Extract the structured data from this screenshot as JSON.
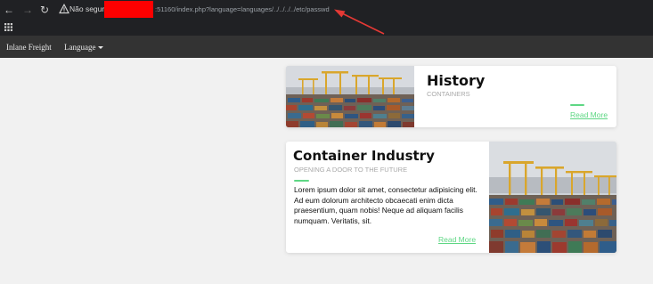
{
  "browser": {
    "security_label": "Não seguro",
    "url": ":51160/index.php?language=languages/../../../../etc/passwd",
    "icons": [
      "back-arrow-icon",
      "forward-arrow-icon",
      "reload-icon",
      "warning-triangle-icon",
      "apps-grid-icon"
    ]
  },
  "nav": {
    "brand": "Inlane Freight",
    "language_menu": "Language"
  },
  "cards": {
    "history": {
      "title": "History",
      "subtitle": "CONTAINERS",
      "link": "Read More"
    },
    "industry": {
      "title": "Container Industry",
      "subtitle": "OPENING A DOOR TO THE FUTURE",
      "body": "Lorem ipsum dolor sit amet, consectetur adipisicing elit. Ad eum dolorum architecto obcaecati enim dicta praesentium, quam nobis! Neque ad aliquam facilis numquam. Veritatis, sit.",
      "link": "Read More"
    }
  },
  "colors": {
    "accent_green": "#5ed784",
    "navbar": "#333333",
    "chrome": "#202124",
    "annotation_red": "#e53935",
    "redaction_red": "#fe0000"
  }
}
